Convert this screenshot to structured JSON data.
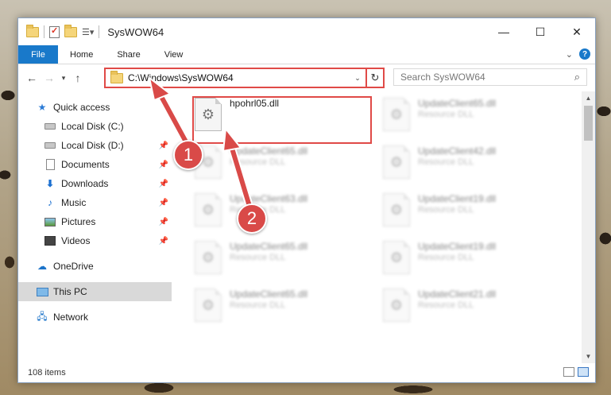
{
  "window": {
    "title": "SysWOW64",
    "controls": {
      "minimize": "—",
      "maximize": "☐",
      "close": "✕"
    }
  },
  "ribbon": {
    "tabs": [
      "File",
      "Home",
      "Share",
      "View"
    ]
  },
  "address_bar": {
    "path": "C:\\Windows\\SysWOW64",
    "search_placeholder": "Search SysWOW64"
  },
  "nav_pane": {
    "quick_access": "Quick access",
    "items": [
      {
        "label": "Local Disk (C:)",
        "icon": "drive-icon",
        "pinned": true
      },
      {
        "label": "Local Disk (D:)",
        "icon": "drive-icon",
        "pinned": true
      },
      {
        "label": "Documents",
        "icon": "documents-icon",
        "pinned": true
      },
      {
        "label": "Downloads",
        "icon": "downloads-icon",
        "pinned": true
      },
      {
        "label": "Music",
        "icon": "music-icon",
        "pinned": true
      },
      {
        "label": "Pictures",
        "icon": "pictures-icon",
        "pinned": true
      },
      {
        "label": "Videos",
        "icon": "videos-icon",
        "pinned": true
      }
    ],
    "onedrive": "OneDrive",
    "this_pc": "This PC",
    "network": "Network"
  },
  "files": {
    "highlighted": {
      "name": "hpohrl05.dll"
    },
    "blurred": [
      {
        "name": "UpdateClient65.dll",
        "type": "Resource DLL"
      },
      {
        "name": "UpdateClient65.dll",
        "type": "Resource DLL"
      },
      {
        "name": "UpdateClient42.dll",
        "type": "Resource DLL"
      },
      {
        "name": "UpdateClient63.dll",
        "type": "Resource DLL"
      },
      {
        "name": "UpdateClient19.dll",
        "type": "Resource DLL"
      },
      {
        "name": "UpdateClient65.dll",
        "type": "Resource DLL"
      },
      {
        "name": "UpdateClient19.dll",
        "type": "Resource DLL"
      },
      {
        "name": "UpdateClient65.dll",
        "type": "Resource DLL"
      },
      {
        "name": "UpdateClient21.dll",
        "type": "Resource DLL"
      }
    ]
  },
  "status": {
    "item_count": "108 items"
  },
  "callouts": [
    "1",
    "2"
  ],
  "colors": {
    "accent": "#1979ca",
    "highlight": "#e04a47"
  }
}
